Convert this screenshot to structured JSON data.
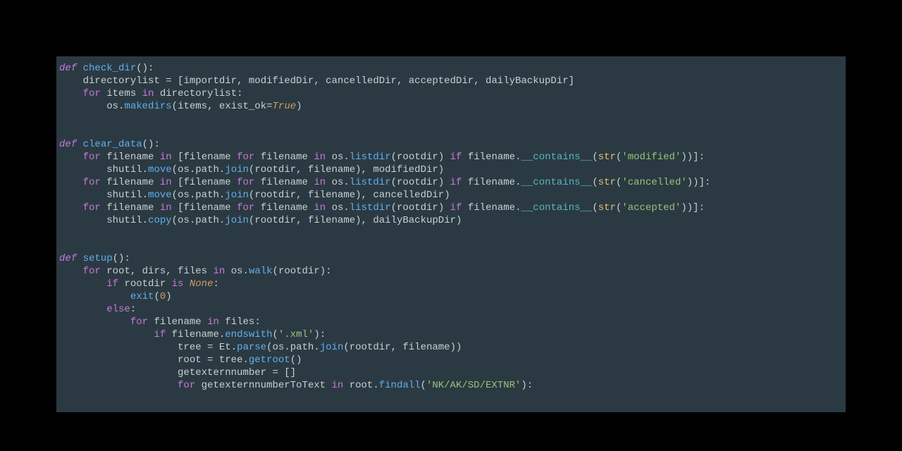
{
  "colors": {
    "background": "#2b3a42",
    "foreground": "#c8d0d4",
    "keyword": "#c678dd",
    "function": "#61afef",
    "builtin": "#e5c07b",
    "method": "#61afef",
    "dunder": "#56b6c2",
    "string": "#98c379",
    "number": "#d19a66",
    "constant": "#d19a66"
  },
  "code": {
    "language": "python",
    "functions": [
      {
        "name": "check_dir",
        "body": [
          "directorylist = [importdir, modifiedDir, cancelledDir, acceptedDir, dailyBackupDir]",
          "for items in directorylist:",
          "    os.makedirs(items, exist_ok=True)"
        ]
      },
      {
        "name": "clear_data",
        "body": [
          "for filename in [filename for filename in os.listdir(rootdir) if filename.__contains__(str('modified'))]:",
          "    shutil.move(os.path.join(rootdir, filename), modifiedDir)",
          "for filename in [filename for filename in os.listdir(rootdir) if filename.__contains__(str('cancelled'))]:",
          "    shutil.move(os.path.join(rootdir, filename), cancelledDir)",
          "for filename in [filename for filename in os.listdir(rootdir) if filename.__contains__(str('accepted'))]:",
          "    shutil.copy(os.path.join(rootdir, filename), dailyBackupDir)"
        ]
      },
      {
        "name": "setup",
        "body": [
          "for root, dirs, files in os.walk(rootdir):",
          "    if rootdir is None:",
          "        exit(0)",
          "    else:",
          "        for filename in files:",
          "            if filename.endswith('.xml'):",
          "                tree = Et.parse(os.path.join(rootdir, filename))",
          "                root = tree.getroot()",
          "                getexternnumber = []",
          "                for getexternnumberToText in root.findall('NK/AK/SD/EXTNR'):"
        ]
      }
    ],
    "tokens": {
      "def": "def",
      "for": "for",
      "in": "in",
      "if": "if",
      "is": "is",
      "else": "else",
      "None": "None",
      "True": "True",
      "str": "str",
      "exit": "exit",
      "fn_check_dir": "check_dir",
      "fn_clear_data": "clear_data",
      "fn_setup": "setup",
      "makedirs": "makedirs",
      "listdir": "listdir",
      "contains": "__contains__",
      "move": "move",
      "copy": "copy",
      "join": "join",
      "walk": "walk",
      "endswith": "endswith",
      "parse": "parse",
      "getroot": "getroot",
      "findall": "findall",
      "str_modified": "'modified'",
      "str_cancelled": "'cancelled'",
      "str_accepted": "'accepted'",
      "str_xml": "'.xml'",
      "str_xpath": "'NK/AK/SD/EXTNR'",
      "num_zero": "0",
      "ident_directorylist": "directorylist",
      "ident_importdir": "importdir",
      "ident_modifiedDir": "modifiedDir",
      "ident_cancelledDir": "cancelledDir",
      "ident_acceptedDir": "acceptedDir",
      "ident_dailyBackupDir": "dailyBackupDir",
      "ident_items": "items",
      "ident_os": "os",
      "ident_exist_ok": "exist_ok",
      "ident_filename": "filename",
      "ident_rootdir": "rootdir",
      "ident_shutil": "shutil",
      "ident_path": "path",
      "ident_root": "root",
      "ident_dirs": "dirs",
      "ident_files": "files",
      "ident_tree": "tree",
      "ident_Et": "Et",
      "ident_getexternnumber": "getexternnumber",
      "ident_getexternnumberToText": "getexternnumberToText"
    }
  }
}
